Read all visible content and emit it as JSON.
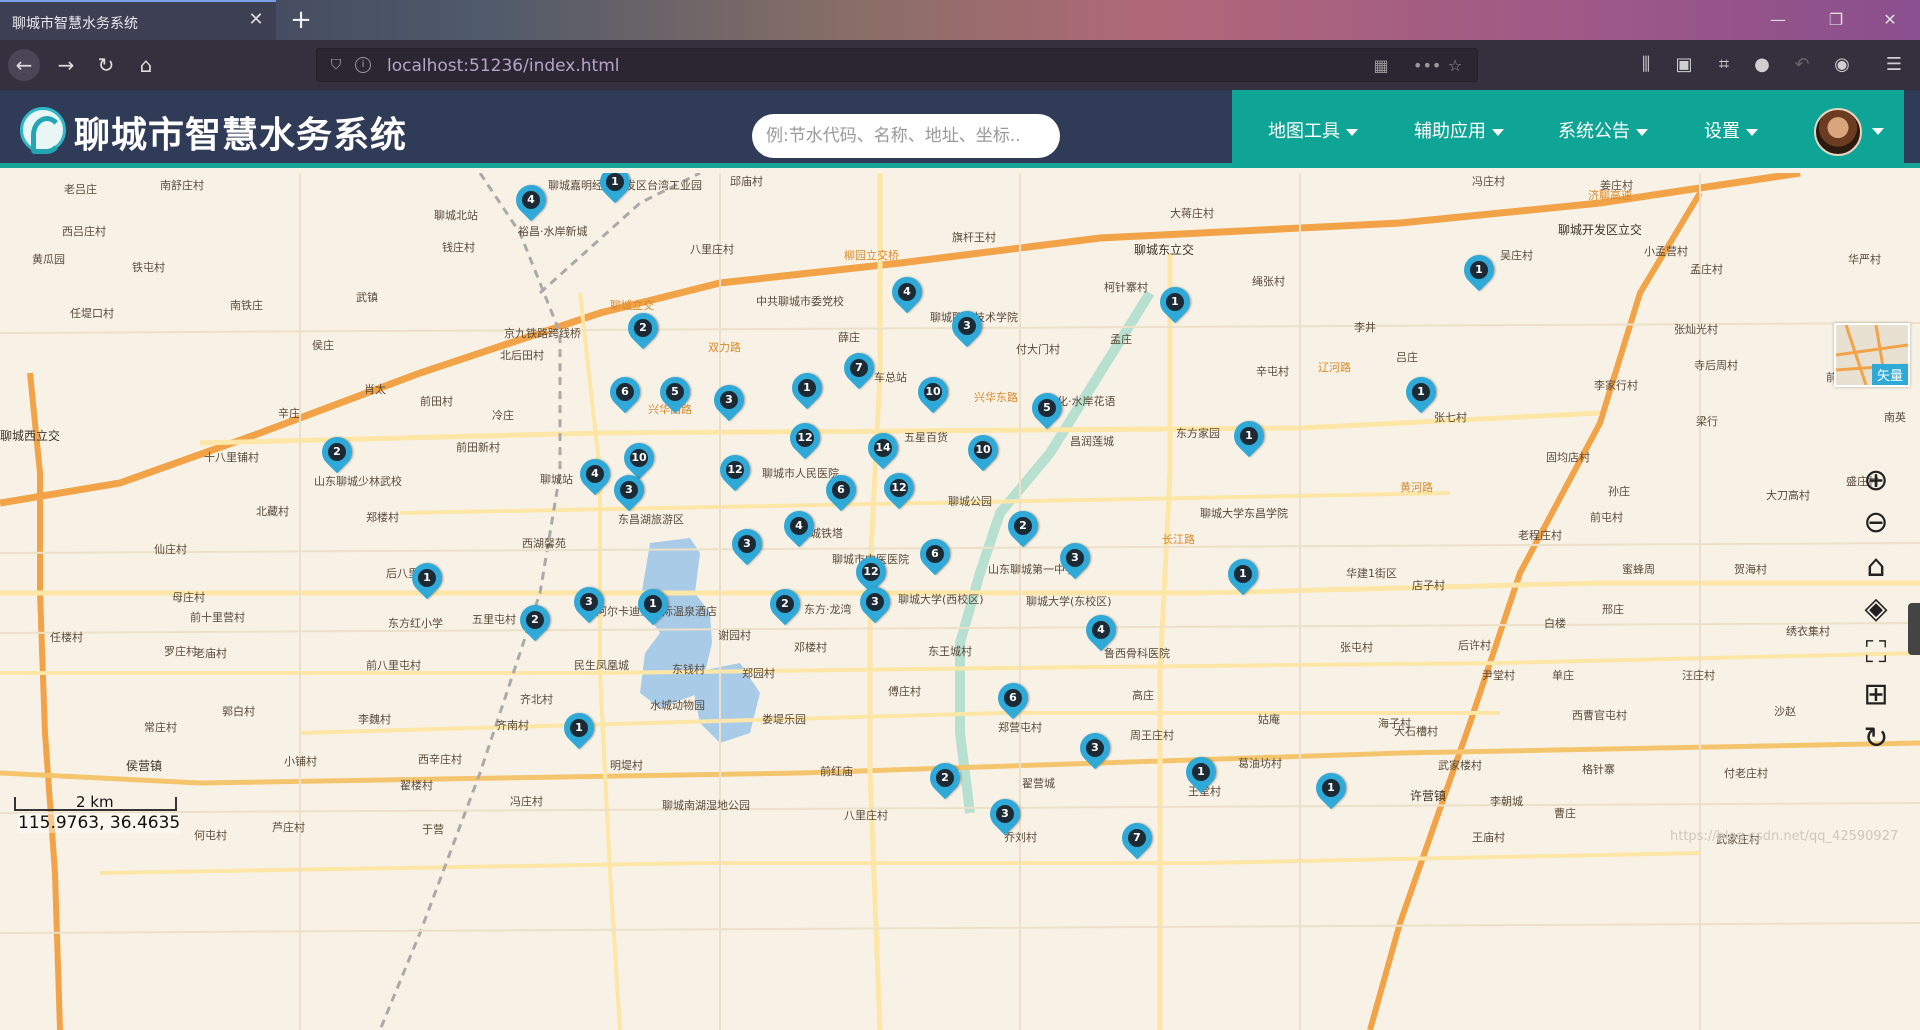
{
  "browser": {
    "tab_title": "聊城市智慧水务系统",
    "url": "localhost:51236/index.html"
  },
  "app": {
    "title": "聊城市智慧水务系统",
    "search_placeholder": "例:节水代码、名称、地址、坐标..",
    "menu": [
      "地图工具",
      "辅助应用",
      "系统公告",
      "设置"
    ]
  },
  "map": {
    "basemap_label": "矢量",
    "scale_label": "2 km",
    "coordinates": "115.9763, 36.4635",
    "watermark": "https://blog.csdn.net/qq_42590927",
    "pins": [
      "1",
      "4",
      "4",
      "2",
      "3",
      "1",
      "1",
      "6",
      "5",
      "3",
      "1",
      "7",
      "10",
      "5",
      "1",
      "1",
      "2",
      "4",
      "10",
      "12",
      "14",
      "10",
      "12",
      "6",
      "12",
      "3",
      "4",
      "2",
      "3",
      "6",
      "3",
      "12",
      "1",
      "3",
      "2",
      "1",
      "2",
      "3",
      "4",
      "1",
      "6",
      "1",
      "3",
      "2",
      "1",
      "1",
      "3",
      "7"
    ],
    "places": [
      "老吕庄",
      "南舒庄村",
      "聊城嘉明经济开发区台湾工业园",
      "邱庙村",
      "冯庄村",
      "姜庄村",
      "聊城北站",
      "裕昌·水岸新城",
      "钱庄村",
      "西吕庄村",
      "黄瓜园",
      "铁屯村",
      "八里庄村",
      "柳园立交桥",
      "旗杆王村",
      "大蒋庄村",
      "聊城东立交",
      "绳张村",
      "聊城开发区立交",
      "吴庄村",
      "孟庄村",
      "华严村",
      "小孟营村",
      "武镇",
      "南铁庄",
      "任堤口村",
      "中共聊城市委党校",
      "聊城立交",
      "聊城职业技术学院",
      "柯针寨村",
      "京九铁路跨线桥",
      "薛庄",
      "付大门村",
      "孟庄",
      "李井",
      "吕庄",
      "张灿光村",
      "寺后周村",
      "前张庄村",
      "侯庄",
      "北后田村",
      "双力路",
      "辛庄",
      "肖太",
      "前田村",
      "冷庄",
      "车总站",
      "文化·水岸花语",
      "昌润莲城",
      "东方家园",
      "辛屯村",
      "张七村",
      "李家行村",
      "梁行",
      "南英",
      "聊城西立交",
      "十八里铺村",
      "前田新村",
      "五星百货",
      "聊城站",
      "聊城市人民医院",
      "聊城公园",
      "固均店村",
      "孙庄",
      "盛庄村",
      "山东聊城少林武校",
      "北藏村",
      "郑楼村",
      "东昌湖旅游区",
      "聊城大学东昌学院",
      "前屯村",
      "大刀高村",
      "仙庄村",
      "西湖馨苑",
      "城铁塔",
      "老程庄村",
      "聊城市中医医院",
      "山东聊城第一中学",
      "华建1街区",
      "店子村",
      "蜜蜂周",
      "贺海村",
      "后八里屯",
      "母庄村",
      "聊城大学(西校区)",
      "邢庄",
      "白楼",
      "东方红小学",
      "罗庄村",
      "前十里营村",
      "阿尔卡迪亚国际温泉酒店",
      "东方·龙湾",
      "聊城大学(东校区)",
      "五里屯村",
      "谢园村",
      "邓楼村",
      "鲁西骨科医院",
      "张屯村",
      "后许村",
      "绣衣集村",
      "任楼村",
      "老庙村",
      "前八里屯村",
      "民生凤凰城",
      "东钱村",
      "郑园村",
      "东王城村",
      "尹堂村",
      "单庄",
      "汪庄村",
      "齐北村",
      "水城动物园",
      "娄堤乐园",
      "傅庄村",
      "高庄",
      "沙赵",
      "郭白村",
      "李魏村",
      "齐南村",
      "郑营屯村",
      "周王庄村",
      "姑庵",
      "海子村",
      "西曹官屯村",
      "常庄村",
      "大石槽村",
      "小铺村",
      "西辛庄村",
      "侯营镇",
      "明堤村",
      "前红庙",
      "翟楼村",
      "武家楼村",
      "格针寨",
      "付老庄村",
      "翟营城",
      "葛油坊村",
      "王堂村",
      "许营镇",
      "李朝城",
      "聊城南湖湿地公园",
      "八里庄村",
      "冯庄村",
      "乔刘村",
      "芦庄村",
      "于营",
      "何屯村",
      "曹庄",
      "王庙村",
      "武家庄村",
      "济聊高速",
      "辽河路",
      "兴华西路",
      "兴华东路",
      "长江路",
      "黄河路"
    ]
  }
}
